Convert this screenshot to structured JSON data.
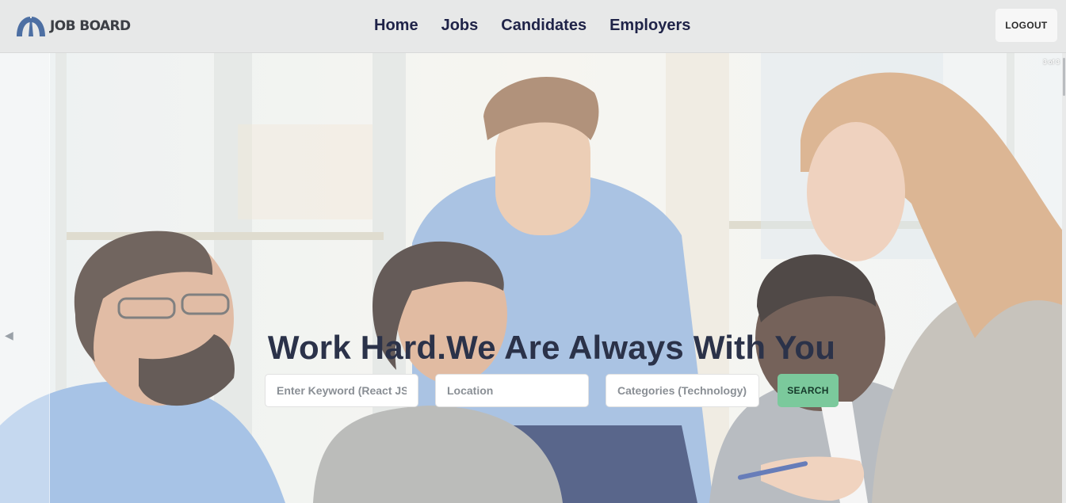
{
  "brand": {
    "name": "JOB BOARD",
    "logo_icon": "arch-logo-icon",
    "logo_color": "#4d6fa3"
  },
  "nav": {
    "links": [
      {
        "label": "Home"
      },
      {
        "label": "Jobs"
      },
      {
        "label": "Candidates"
      },
      {
        "label": "Employers"
      }
    ],
    "logout_label": "LOGOUT"
  },
  "hero": {
    "title": "Work Hard.We Are Always With You",
    "slide_counter": "3 of 3",
    "prev_icon": "chevron-left-icon",
    "image_description_icon": "team-photo"
  },
  "search": {
    "keyword_placeholder": "Enter Keyword (React JS)",
    "location_placeholder": "Location",
    "category_placeholder": "Categories (Technology)",
    "button_label": "SEARCH",
    "button_color": "#7bc99c"
  },
  "colors": {
    "navbar_bg": "#e7e8e8",
    "nav_text": "#1f2348",
    "title_text": "#2b3249"
  }
}
